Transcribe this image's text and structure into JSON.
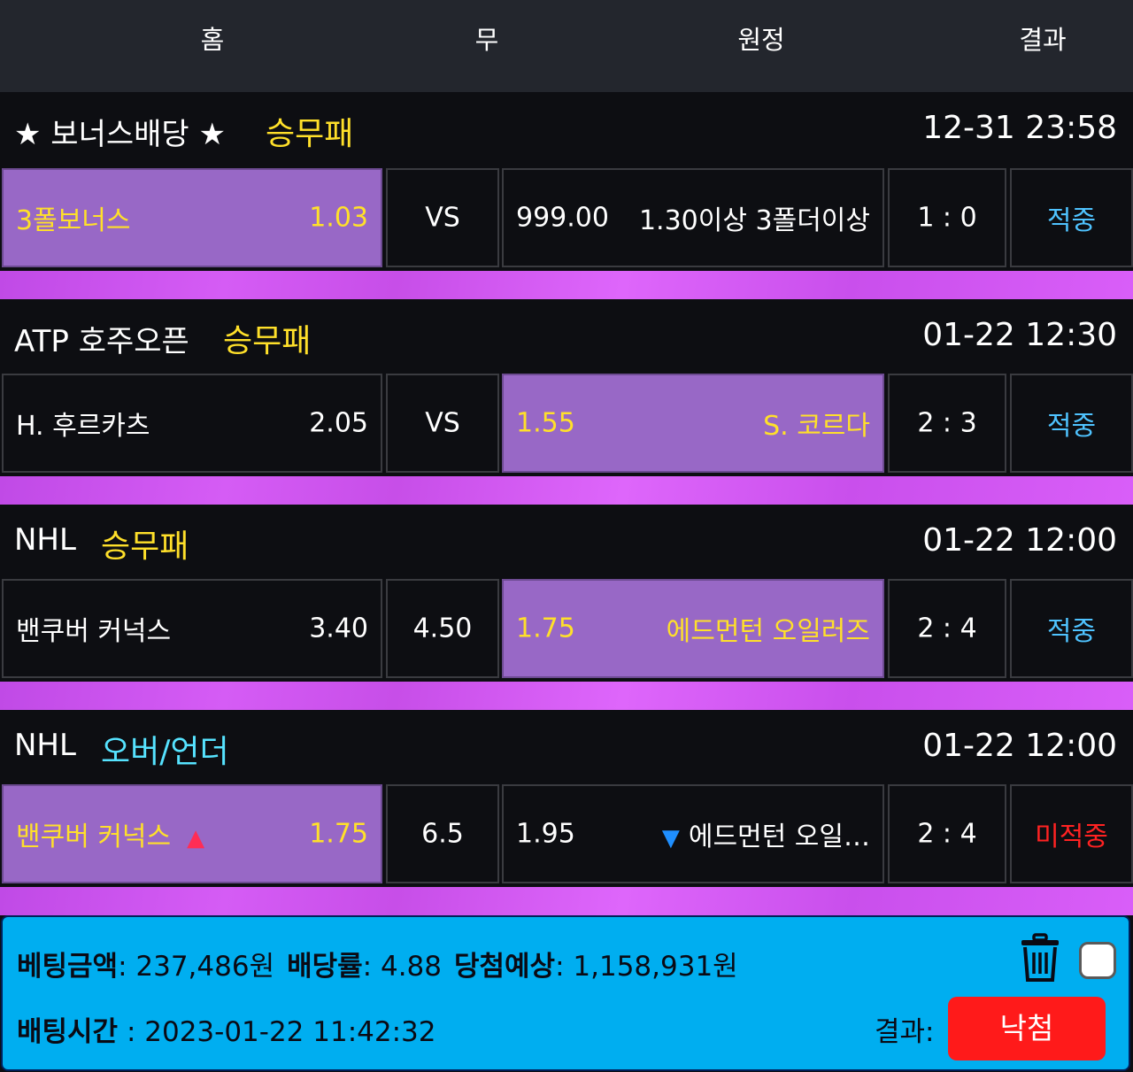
{
  "header": {
    "home_label": "홈",
    "draw_label": "무",
    "away_label": "원정",
    "result_label": "결과"
  },
  "bets": [
    {
      "league": "★ 보너스배당 ★",
      "bet_type": "승무패",
      "time": "12-31 23:58",
      "home_team": "3폴보너스",
      "home_odds": "1.03",
      "draw": "VS",
      "away_odds": "999.00",
      "away_team": "1.30이상 3폴더이상",
      "score": "1 : 0",
      "result": "적중",
      "selected": "home"
    },
    {
      "league": "ATP 호주오픈",
      "bet_type": "승무패",
      "time": "01-22 12:30",
      "home_team": "H. 후르카츠",
      "home_odds": "2.05",
      "draw": "VS",
      "away_odds": "1.55",
      "away_team": "S. 코르다",
      "score": "2 : 3",
      "result": "적중",
      "selected": "away"
    },
    {
      "league": "NHL",
      "bet_type": "승무패",
      "time": "01-22 12:00",
      "home_team": "밴쿠버 커넉스",
      "home_odds": "3.40",
      "draw": "4.50",
      "away_odds": "1.75",
      "away_team": "에드먼턴 오일러즈",
      "score": "2 : 4",
      "result": "적중",
      "selected": "away"
    },
    {
      "league": "NHL",
      "bet_type": "오버/언더",
      "time": "01-22 12:00",
      "home_team": "밴쿠버 커넉스",
      "home_indicator": "▲",
      "home_odds": "1.75",
      "draw": "6.5",
      "away_odds": "1.95",
      "away_indicator": "▼",
      "away_team": "에드먼턴 오일…",
      "score": "2 : 4",
      "result": "미적중",
      "selected": "home"
    }
  ],
  "summary": {
    "bet_amount_label": "베팅금액",
    "bet_amount": ": 237,486원",
    "odds_label": "배당률",
    "odds": ": 4.88",
    "expected_label": "당첨예상",
    "expected": ": 1,158,931원",
    "bet_time_label": "배팅시간",
    "bet_time": " : 2023-01-22 11:42:32",
    "result_label": "결과:",
    "result_value": "낙첨"
  },
  "colors": {
    "selected_bg": "#9868c6",
    "separator": "#d55cf5",
    "footer_bg": "#00aef0",
    "hit": "#4fc3ff",
    "miss": "#ff2222",
    "lose_button": "#ff1a1a"
  }
}
